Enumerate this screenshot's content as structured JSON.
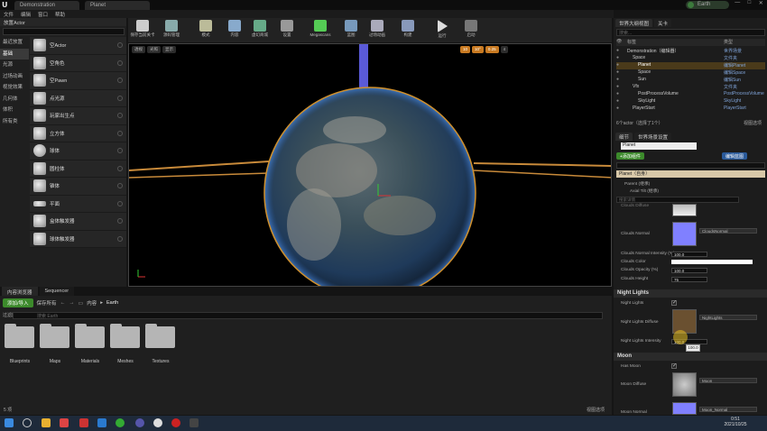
{
  "title": {
    "tab1": "Demonstration",
    "tab2": "Planet",
    "user": "Earth",
    "win": [
      "—",
      "□",
      "✕"
    ]
  },
  "menu": [
    "文件",
    "编辑",
    "窗口",
    "帮助"
  ],
  "left_panel": {
    "header": "放置Actor",
    "categories": [
      "最近放置",
      "基础",
      "光源",
      "过场动画",
      "视觉效果",
      "几何体",
      "体积",
      "所有类"
    ],
    "selected_category": 1,
    "items": [
      "空Actor",
      "空角色",
      "空Pawn",
      "点光源",
      "玩家出生点",
      "立方体",
      "球体",
      "圆柱体",
      "锥体",
      "平面",
      "盒体触发器",
      "球体触发器"
    ]
  },
  "toolbar": {
    "buttons": [
      "保存当前关卡",
      "源码管理",
      "模式",
      "内容",
      "虚幻商城",
      "设置",
      "Megascans",
      "蓝图",
      "过场动画",
      "构建",
      "运行",
      "启动"
    ]
  },
  "viewport": {
    "left_btns": [
      "透视",
      "光照",
      "显示"
    ],
    "right_btns": [
      "10",
      "10°",
      "0.25",
      "4"
    ]
  },
  "outliner": {
    "tab": "世界大纲视图",
    "tab2": "关卡",
    "search_placeholder": "搜索...",
    "col_label": "标签",
    "col_type": "类型",
    "rows": [
      {
        "name": "Demonstration（编辑器）",
        "type": "世界场景"
      },
      {
        "name": "Space",
        "type": "文件夹"
      },
      {
        "name": "Planet",
        "type": "编辑Planet"
      },
      {
        "name": "Space",
        "type": "编辑Space"
      },
      {
        "name": "Sun",
        "type": "编辑Sun"
      },
      {
        "name": "Vfx",
        "type": "文件夹"
      },
      {
        "name": "PostProcessVolume",
        "type": "PostProcessVolume"
      },
      {
        "name": "SkyLight",
        "type": "SkyLight"
      },
      {
        "name": "PlayerStart",
        "type": "PlayerStart"
      }
    ],
    "footer": "6个actor（选择了1个）",
    "view_options": "视图选项"
  },
  "details": {
    "tab": "细节",
    "tab2": "世界场景设置",
    "actor_name": "Planet",
    "add_component": "+添加组件",
    "edit_blueprint": "编辑蓝图",
    "instance": "Planet（自身）",
    "parent": "Parent (继承)",
    "axial": "Axial Tilt (继承)",
    "search_placeholder": "搜索详情",
    "clouds_diffuse": "Clouds Diffuse",
    "clouds_normal": "Clouds Normal",
    "clouds_normal_value": "CloudsNormal",
    "clouds_normal_intensity": "Clouds Normal Intensity (%)",
    "clouds_normal_intensity_val": "100.0",
    "clouds_color": "Clouds Color",
    "clouds_opacity": "Clouds Opacity (%)",
    "clouds_opacity_val": "100.0",
    "clouds_height": "Clouds Height",
    "clouds_height_val": "75",
    "night_section": "Night Lights",
    "night_lights": "Night Lights",
    "night_diffuse": "Night Lights Diffuse",
    "night_diffuse_value": "NightLights",
    "night_intensity": "Night Lights Intensity",
    "night_intensity_val": "100.0",
    "tooltip": "100.0",
    "moon_section": "Moon",
    "has_moon": "Has Moon",
    "moon_diffuse": "Moon Diffuse",
    "moon_diffuse_value": "Moon",
    "moon_normal": "Moon Normal",
    "moon_normal_value": "Moon_Normal"
  },
  "content_browser": {
    "tab": "内容浏览器",
    "tab2": "Sequencer",
    "add_button": "添加/导入",
    "save_all": "保存所有",
    "path": [
      "内容",
      "Earth"
    ],
    "filter": "过滤器",
    "search_placeholder": "搜索 Earth",
    "folders": [
      "Blueprints",
      "Maps",
      "Materials",
      "Meshes",
      "Textures"
    ],
    "item_count": "5 项",
    "view_options": "视图选项"
  },
  "taskbar": {
    "time": "0:51",
    "date": "2021/10/25"
  }
}
